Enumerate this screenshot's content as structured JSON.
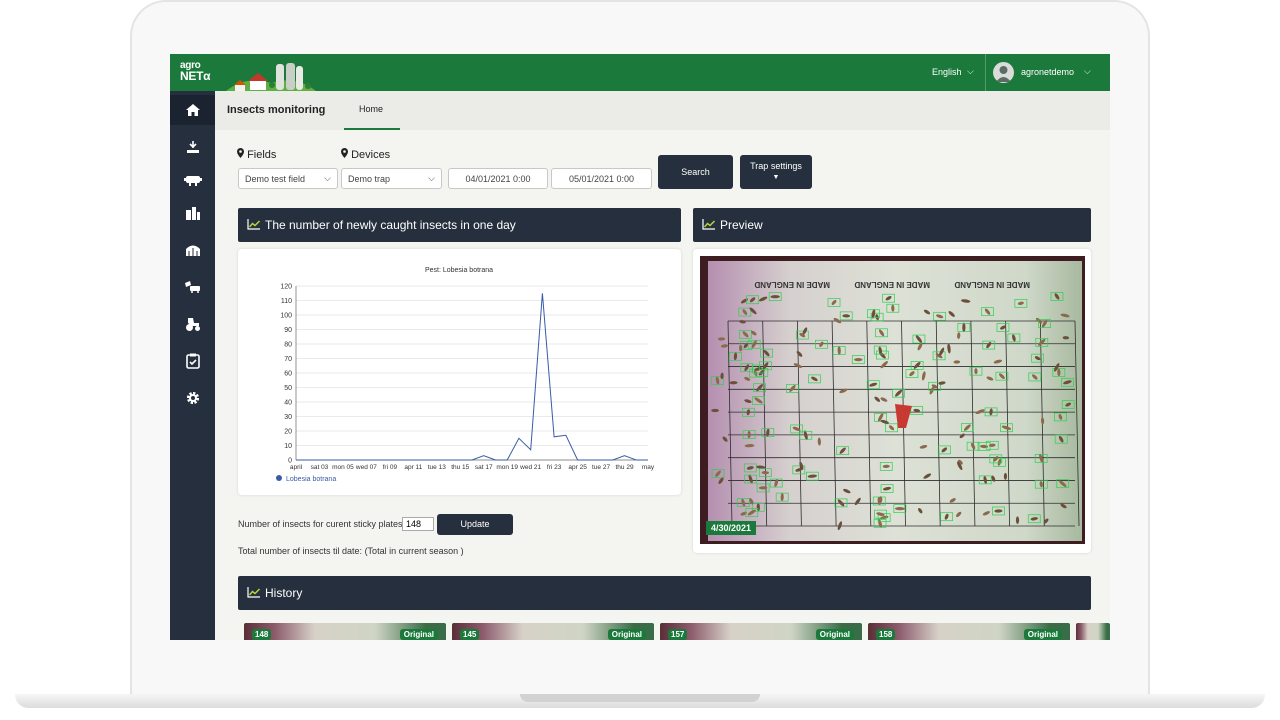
{
  "brand": {
    "line1": "agro",
    "line2": "NETα"
  },
  "header": {
    "language": "English",
    "username": "agronetdemo"
  },
  "sidebar_icons": [
    "home-icon",
    "field-icon",
    "device-icon",
    "storage-icon",
    "greenhouse-icon",
    "spray-icon",
    "tractor-icon",
    "task-icon",
    "gear-icon"
  ],
  "tabs": {
    "app_title": "Insects monitoring",
    "home": "Home"
  },
  "filters": {
    "fields_label": "Fields",
    "devices_label": "Devices",
    "field_value": "Demo test field",
    "device_value": "Demo trap",
    "date_from": "04/01/2021 0:00",
    "date_to": "05/01/2021 0:00",
    "search_label": "Search",
    "trap_settings_label": "Trap settings"
  },
  "chart_panel": {
    "title": "The number of newly caught insects in one day"
  },
  "preview_panel": {
    "title": "Preview",
    "date": "4/30/2021",
    "label_text": "MADE IN ENGLAND"
  },
  "history_panel": {
    "title": "History"
  },
  "sticky": {
    "label": "Number of insects for curent sticky plates:",
    "value": "148",
    "update_label": "Update",
    "total_text": "Total number of insects til date: (Total in current season )"
  },
  "history": [
    {
      "count": "148",
      "label": "Original"
    },
    {
      "count": "145",
      "label": "Original"
    },
    {
      "count": "157",
      "label": "Original"
    },
    {
      "count": "158",
      "label": "Original"
    }
  ],
  "colors": {
    "brand_green": "#1b7a3b",
    "dark_navy": "#262f3d",
    "series_blue": "#3a5ba8",
    "accent_lime": "#b5d334"
  },
  "chart_data": {
    "type": "line",
    "title": "Pest: Lobesia botrana",
    "xlabel": "",
    "ylabel": "",
    "ylim": [
      0,
      120
    ],
    "yticks": [
      0,
      10,
      20,
      30,
      40,
      50,
      60,
      70,
      80,
      90,
      100,
      110,
      120
    ],
    "x_tick_labels": [
      "april",
      "sat 03",
      "mon 05",
      "wed 07",
      "fri 09",
      "apr 11",
      "tue 13",
      "thu 15",
      "sat 17",
      "mon 19",
      "wed 21",
      "fri 23",
      "apr 25",
      "tue 27",
      "thu 29",
      "may"
    ],
    "grid": true,
    "legend": "bottom-left",
    "series": [
      {
        "name": "Lobesia botrana",
        "x": [
          0,
          1,
          2,
          3,
          4,
          5,
          6,
          7,
          8,
          9,
          10,
          11,
          12,
          13,
          14,
          15,
          16,
          17,
          18,
          19,
          20,
          21,
          22,
          23,
          24,
          25,
          26,
          27,
          28,
          29,
          30
        ],
        "values": [
          0,
          0,
          0,
          0,
          0,
          0,
          0,
          0,
          0,
          0,
          0,
          0,
          0,
          0,
          0,
          0,
          3,
          0,
          0,
          15,
          7,
          115,
          16,
          17,
          0,
          0,
          0,
          0,
          3,
          0,
          0
        ]
      }
    ]
  }
}
